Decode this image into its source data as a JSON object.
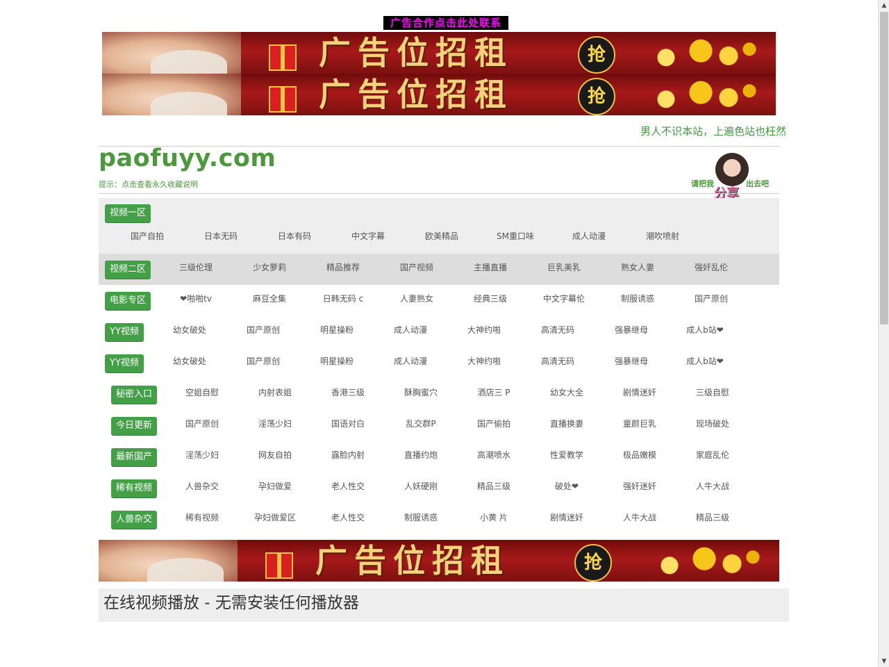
{
  "ad_contact": "广告合作点击此处联系",
  "banner": {
    "text": "广告位招租",
    "grab": "抢"
  },
  "slogan": "男人不识本站，上遍色站也枉然",
  "site": {
    "logo": "paofuyy.com",
    "tip": "提示：点击查看永久收藏说明"
  },
  "share": {
    "left": "请把我",
    "right": "出去吧",
    "big": "分享"
  },
  "nav": [
    {
      "category": "视频一区",
      "links": [
        "国产自拍",
        "日本无码",
        "日本有码",
        "中文字幕",
        "欧美精品",
        "SM重口味",
        "成人动漫",
        "潮吹喷射"
      ]
    },
    {
      "category": "视频二区",
      "links": [
        "三级伦理",
        "少女萝莉",
        "精品推荐",
        "国产视频",
        "主播直播",
        "巨乳美乳",
        "熟女人妻",
        "强奸乱伦"
      ]
    },
    {
      "category": "电影专区",
      "links": [
        "❤啪啪tv",
        "麻豆全集",
        "日韩无码 c",
        "人妻熟女",
        "经典三级",
        "中文字幕伦",
        "制服诱惑",
        "国产原创"
      ]
    },
    {
      "category": "YY视频",
      "links": [
        "幼女破处",
        "国产原创",
        "明星操粉",
        "成人动漫",
        "大神约啪",
        "高清无码",
        "强暴继母",
        "成人b站❤"
      ]
    },
    {
      "category": "YY视频",
      "links": [
        "幼女破处",
        "国产原创",
        "明星操粉",
        "成人动漫",
        "大神约啪",
        "高清无码",
        "强暴继母",
        "成人b站❤"
      ]
    },
    {
      "category": "秘密入口",
      "links": [
        "空姐自慰",
        "内射表姐",
        "香港三级",
        "酥胸蜜穴",
        "酒店三 P",
        "幼女大全",
        "剧情迷奸",
        "三级自慰"
      ]
    },
    {
      "category": "今日更新",
      "links": [
        "国产原创",
        "淫荡少妇",
        "国语对白",
        "乱交群P",
        "国产偷拍",
        "直播换妻",
        "童颜巨乳",
        "现场破处"
      ]
    },
    {
      "category": "最新国产",
      "links": [
        "淫荡少妇",
        "网友自拍",
        "露脸内射",
        "直播约炮",
        "高潮喷水",
        "性爱教学",
        "极品嫩模",
        "家庭乱伦"
      ]
    },
    {
      "category": "稀有视频",
      "links": [
        "人兽杂交",
        "孕妇做爱",
        "老人性交",
        "人妖硬刚",
        "精品三级",
        "破处❤",
        "强奸迷奸",
        "人牛大战"
      ]
    },
    {
      "category": "人兽杂交",
      "links": [
        "稀有视频",
        "孕妇做爱区",
        "老人性交",
        "制服诱惑",
        "小黄 片",
        "剧情迷奸",
        "人牛大战",
        "精品三级"
      ]
    }
  ],
  "online_title": "在线视频播放 - 无需安装任何播放器",
  "scrollbar": {
    "up": "▲",
    "down": "▼"
  },
  "colors": {
    "green": "#43a047",
    "text_green": "#4a9a3c",
    "ad_bg": "#a8191a",
    "ad_text": "#f6d27a"
  }
}
